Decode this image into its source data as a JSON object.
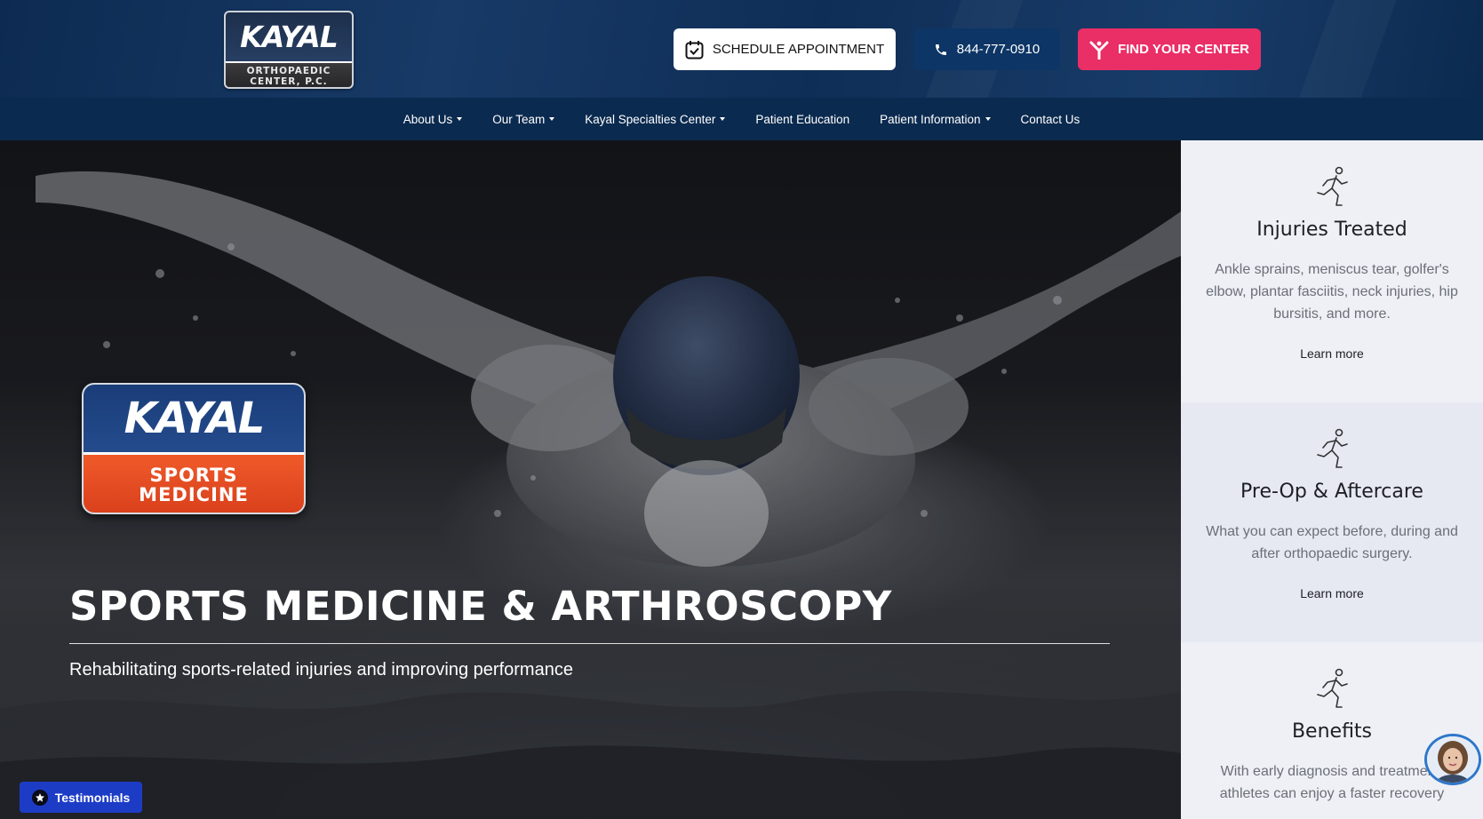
{
  "header": {
    "logo": {
      "word": "KAYAL",
      "line1": "ORTHOPAEDIC",
      "line2": "CENTER, P.C."
    },
    "buttons": {
      "schedule": "SCHEDULE APPOINTMENT",
      "phone": "844-777-0910",
      "find": "FIND YOUR CENTER"
    },
    "colors": {
      "topbar": "#0d2b52",
      "phone_button": "#0d3565",
      "find_button": "#ea2e66"
    }
  },
  "nav": {
    "items": [
      {
        "label": "About Us",
        "dropdown": true
      },
      {
        "label": "Our Team",
        "dropdown": true
      },
      {
        "label": "Kayal Specialties Center",
        "dropdown": true
      },
      {
        "label": "Patient Education",
        "dropdown": false
      },
      {
        "label": "Patient Information",
        "dropdown": true
      },
      {
        "label": "Contact Us",
        "dropdown": false
      }
    ]
  },
  "hero": {
    "logo": {
      "word": "KAYAL",
      "line1": "SPORTS",
      "line2": "MEDICINE"
    },
    "title": "SPORTS MEDICINE & ARTHROSCOPY",
    "subtitle": "Rehabilitating sports-related injuries and improving performance",
    "testimonials_label": "Testimonials"
  },
  "sidebar": {
    "cards": [
      {
        "title": "Injuries Treated",
        "text": "Ankle sprains, meniscus tear, golfer's elbow, plantar fasciitis, neck injuries, hip bursitis, and more.",
        "link": "Learn more",
        "icon": "runner-icon"
      },
      {
        "title": "Pre-Op & Aftercare",
        "text": "What you can expect before, during and after orthopaedic surgery.",
        "link": "Learn more",
        "icon": "runner-icon"
      },
      {
        "title": "Benefits",
        "text": "With early diagnosis and treatment, athletes can enjoy a faster recovery",
        "icon": "runner-icon"
      }
    ]
  },
  "icons": {
    "schedule": "calendar-check-icon",
    "phone": "phone-icon",
    "find": "person-y-icon",
    "testimonials": "badge-icon",
    "chat": "chat-avatar-icon"
  }
}
